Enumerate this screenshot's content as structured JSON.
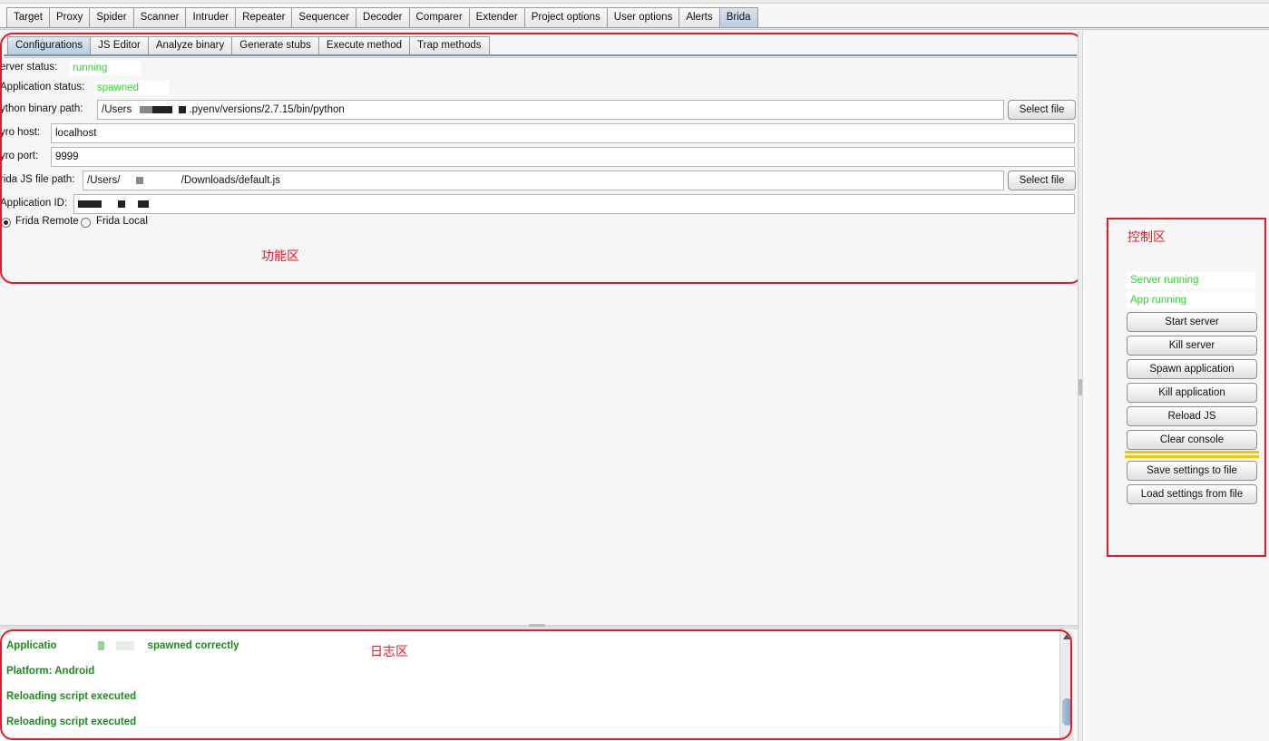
{
  "main_tabs": [
    "Target",
    "Proxy",
    "Spider",
    "Scanner",
    "Intruder",
    "Repeater",
    "Sequencer",
    "Decoder",
    "Comparer",
    "Extender",
    "Project options",
    "User options",
    "Alerts",
    "Brida"
  ],
  "main_active": "Brida",
  "sub_tabs": [
    "Configurations",
    "JS Editor",
    "Analyze binary",
    "Generate stubs",
    "Execute method",
    "Trap methods"
  ],
  "sub_active": "Configurations",
  "config": {
    "server_status_label": "erver status:",
    "server_status_value": "running",
    "app_status_label": "Application status:",
    "app_status_value": "spawned",
    "python_label": "ython binary path:",
    "python_prefix": "/Users",
    "python_suffix": ".pyenv/versions/2.7.15/bin/python",
    "select_file_label": "Select file",
    "pyro_host_label": "yro host:",
    "pyro_host_value": "localhost",
    "pyro_port_label": "yro port:",
    "pyro_port_value": "9999",
    "frida_js_label": "rida JS file path:",
    "frida_js_prefix": "/Users/",
    "frida_js_suffix": "/Downloads/default.js",
    "app_id_label": "Application ID:",
    "radio_remote": "Frida Remote",
    "radio_local": "Frida Local",
    "radio_selected": "Frida Remote"
  },
  "annotations": {
    "function_area": "功能区",
    "control_area": "控制区",
    "log_area": "日志区"
  },
  "console_lines": [
    {
      "prefix": "Applicatio",
      "suffix": "spawned correctly"
    },
    {
      "prefix": "Platform: Android",
      "suffix": ""
    },
    {
      "prefix": "Reloading script executed",
      "suffix": ""
    },
    {
      "prefix": "Reloading script executed",
      "suffix": ""
    }
  ],
  "control": {
    "server_status": "Server running",
    "app_status": "App running",
    "buttons": [
      "Start server",
      "Kill server",
      "Spawn application",
      "Kill application",
      "Reload JS",
      "Clear console"
    ],
    "settings_buttons": [
      "Save settings to file",
      "Load settings from file"
    ]
  },
  "colors": {
    "status_green": "#2bd62b",
    "console_green": "#1b8c1b",
    "annotation_red": "#e01c2b",
    "separator_yellow": "#f5c400"
  }
}
